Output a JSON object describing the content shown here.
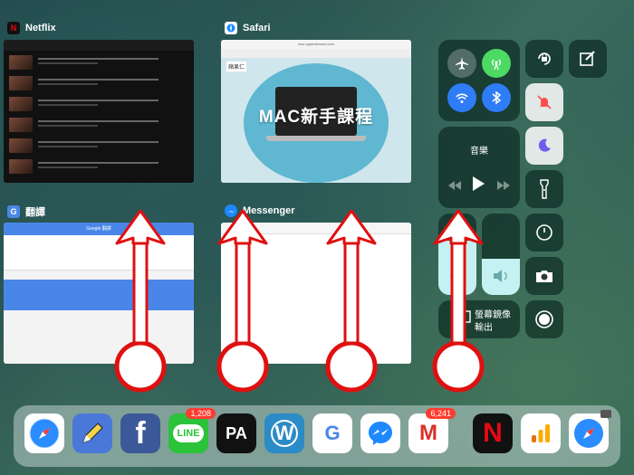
{
  "app_switcher": {
    "cards": [
      {
        "name": "Netflix",
        "badge": "N"
      },
      {
        "name": "Safari"
      },
      {
        "name": "翻譯"
      },
      {
        "name": "Messenger"
      }
    ],
    "safari_page": {
      "headline": "MAC新手課程",
      "logo_text": "蘋果仁",
      "url": "mac.applealmond.com"
    },
    "translate_page": {
      "header": "Google 翻譯"
    }
  },
  "control_center": {
    "media": {
      "label": "音樂"
    },
    "screen_mirroring": {
      "label_line1": "螢幕鏡像",
      "label_line2": "輸出"
    },
    "colors": {
      "airplane": "#f19f2c",
      "cellular": "#4cd964",
      "wifi": "#2e7cf6",
      "bluetooth": "#2e7cf6",
      "mute": "#ff4d4f",
      "moon": "#6e5cf0"
    },
    "icons": [
      "airplane-icon",
      "cellular-icon",
      "wifi-icon",
      "bluetooth-icon",
      "rotation-lock-icon",
      "note-icon",
      "mute-icon",
      "moon-icon",
      "flashlight-icon",
      "timer-icon",
      "camera-icon",
      "record-icon",
      "play-icon",
      "rewind-icon",
      "forward-icon",
      "brightness-icon",
      "volume-icon",
      "screen-mirror-icon"
    ]
  },
  "dock": {
    "apps": [
      {
        "name": "Safari",
        "icon": "safari-icon"
      },
      {
        "name": "Pencil",
        "icon": "pencil-icon"
      },
      {
        "name": "Facebook",
        "icon": "facebook-icon",
        "glyph": "f"
      },
      {
        "name": "LINE",
        "icon": "line-icon",
        "glyph": "LINE",
        "badge": "1,208"
      },
      {
        "name": "PicsArt",
        "icon": "pa-icon",
        "glyph": "PA"
      },
      {
        "name": "WordPress",
        "icon": "wordpress-icon",
        "glyph": "W"
      },
      {
        "name": "Google Translate",
        "icon": "translate-icon",
        "glyph": "G"
      },
      {
        "name": "Messenger",
        "icon": "messenger-icon"
      },
      {
        "name": "Gmail",
        "icon": "gmail-icon",
        "glyph": "M",
        "badge": "6,241"
      },
      {
        "name": "Netflix",
        "icon": "netflix-icon",
        "glyph": "N"
      },
      {
        "name": "Analytics",
        "icon": "analytics-icon"
      },
      {
        "name": "Safari",
        "icon": "safari-icon"
      }
    ]
  }
}
